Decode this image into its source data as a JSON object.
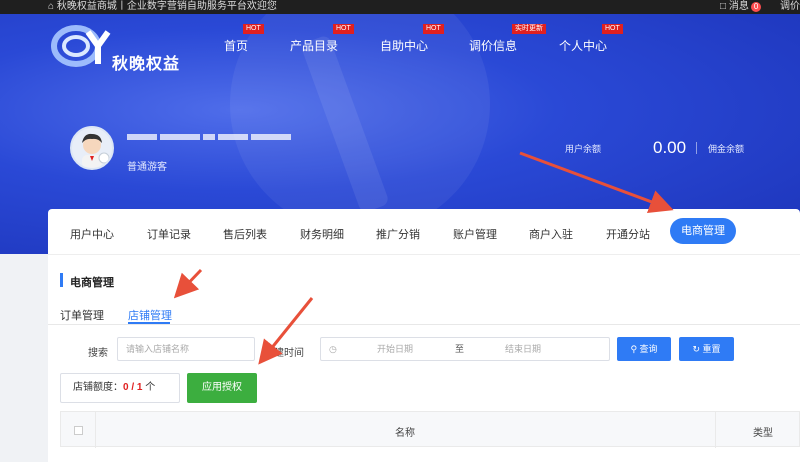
{
  "topbar": {
    "site_text": "秋晚权益商城丨企业数字营销自助服务平台欢迎您",
    "messages_label": "消息",
    "messages_count": "0",
    "right_text": "调价"
  },
  "logo": {
    "text": "秋晚权益"
  },
  "nav": [
    {
      "label": "首页",
      "tag": "HOT"
    },
    {
      "label": "产品目录",
      "tag": "HOT"
    },
    {
      "label": "自助中心",
      "tag": "HOT"
    },
    {
      "label": "调价信息",
      "tag": "实时更新"
    },
    {
      "label": "个人中心",
      "tag": "HOT"
    }
  ],
  "user": {
    "type": "普通游客",
    "balance_label": "用户余额",
    "balance_value": "0.00",
    "commission_label": "佣金余额"
  },
  "tabs": [
    "用户中心",
    "订单记录",
    "售后列表",
    "财务明细",
    "推广分销",
    "账户管理",
    "商户入驻",
    "开通分站",
    "电商管理"
  ],
  "section": {
    "title": "电商管理",
    "subtabs": [
      "订单管理",
      "店铺管理"
    ]
  },
  "filters": {
    "search_label": "搜索",
    "search_placeholder": "请输入店铺名称",
    "created_label": "创建时间",
    "start_placeholder": "开始日期",
    "to_label": "至",
    "end_placeholder": "结束日期",
    "query_button": "查询",
    "reset_button": "重置"
  },
  "quota": {
    "label": "店铺额度：",
    "value": "0 / 1",
    "unit": "个"
  },
  "apply_button": "应用授权",
  "table": {
    "col_name": "名称",
    "col_type": "类型"
  },
  "colors": {
    "primary": "#2f7bf5",
    "green": "#3cae3f",
    "hero": "#2a49d6",
    "arrow": "#e8503a"
  }
}
